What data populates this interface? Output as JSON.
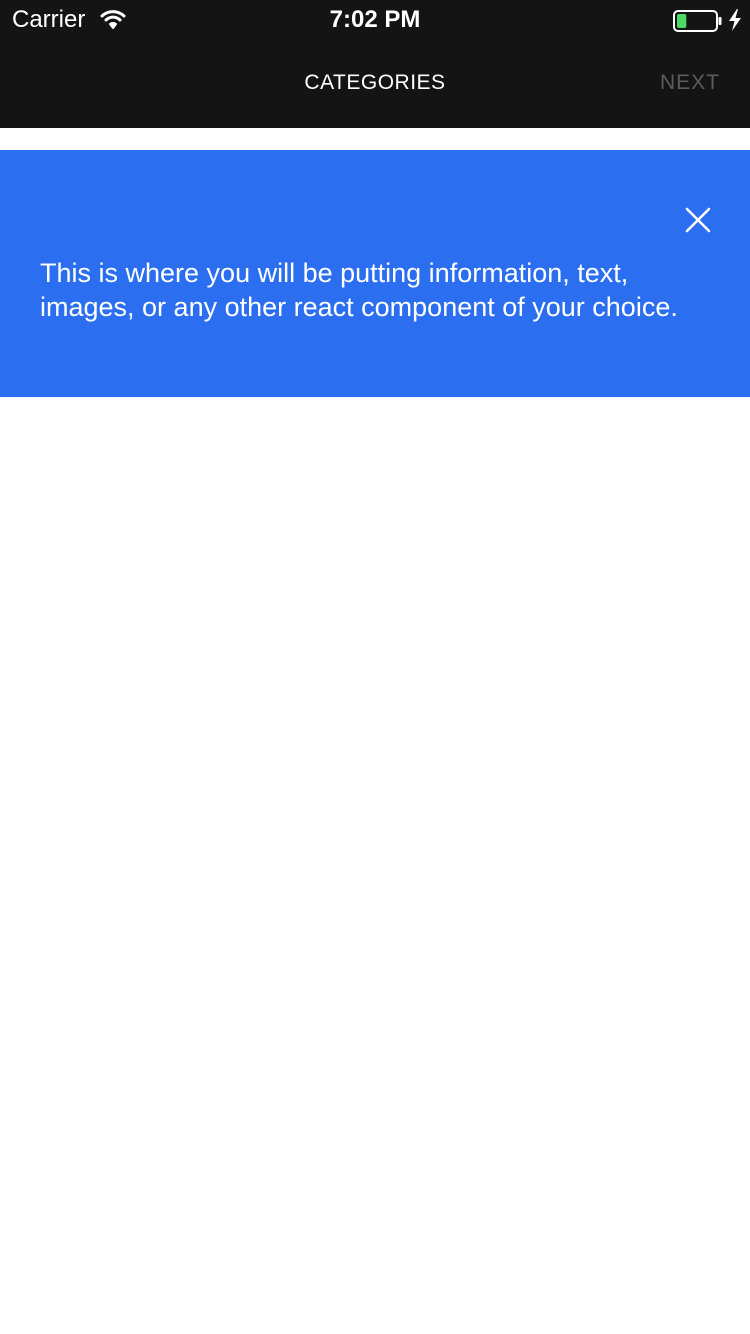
{
  "status_bar": {
    "carrier": "Carrier",
    "time": "7:02 PM",
    "wifi_icon": "wifi-icon",
    "battery_icon": "battery-icon",
    "charging_icon": "charging-bolt-icon",
    "battery_level": 0.25,
    "battery_color": "#4cd964"
  },
  "nav_bar": {
    "title": "CATEGORIES",
    "next_label": "NEXT",
    "background_color": "#141414",
    "next_color": "#5c5c5c"
  },
  "banner": {
    "message": "This is where you will be putting information, text, images, or any other react component of your choice.",
    "close_icon": "close-icon",
    "background_color": "#2b6ff0"
  }
}
